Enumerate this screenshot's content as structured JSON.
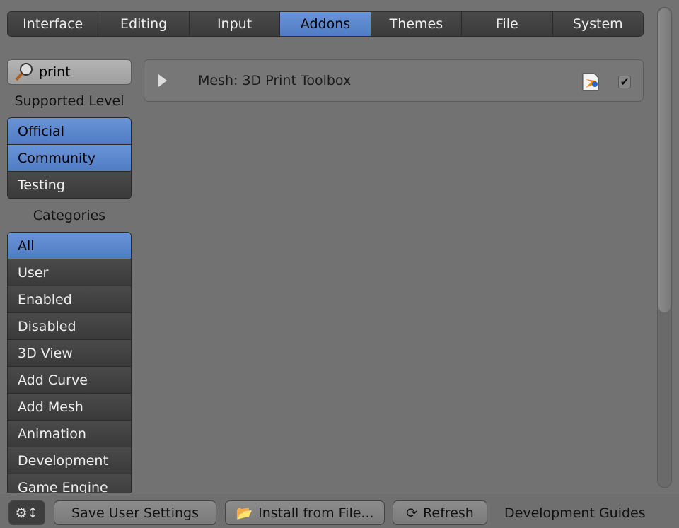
{
  "tabs": [
    {
      "label": "Interface"
    },
    {
      "label": "Editing"
    },
    {
      "label": "Input"
    },
    {
      "label": "Addons",
      "active": true
    },
    {
      "label": "Themes"
    },
    {
      "label": "File"
    },
    {
      "label": "System"
    }
  ],
  "search": {
    "value": "print",
    "icon": "search-icon"
  },
  "supported_level": {
    "label": "Supported Level",
    "items": [
      {
        "label": "Official",
        "selected": true
      },
      {
        "label": "Community",
        "selected": true
      },
      {
        "label": "Testing",
        "selected": false
      }
    ]
  },
  "categories": {
    "label": "Categories",
    "items": [
      {
        "label": "All",
        "selected": true
      },
      {
        "label": "User"
      },
      {
        "label": "Enabled"
      },
      {
        "label": "Disabled"
      },
      {
        "label": "3D View"
      },
      {
        "label": "Add Curve"
      },
      {
        "label": "Add Mesh"
      },
      {
        "label": "Animation"
      },
      {
        "label": "Development"
      },
      {
        "label": "Game Engine"
      }
    ]
  },
  "addons": [
    {
      "name": "Mesh: 3D Print Toolbox",
      "enabled": true,
      "icon": "blender-file-icon"
    }
  ],
  "footer": {
    "save": "Save User Settings",
    "install": "Install from File...",
    "refresh": "Refresh",
    "guides": "Development Guides"
  },
  "colors": {
    "accent": "#5a87cf",
    "background": "#727272"
  }
}
